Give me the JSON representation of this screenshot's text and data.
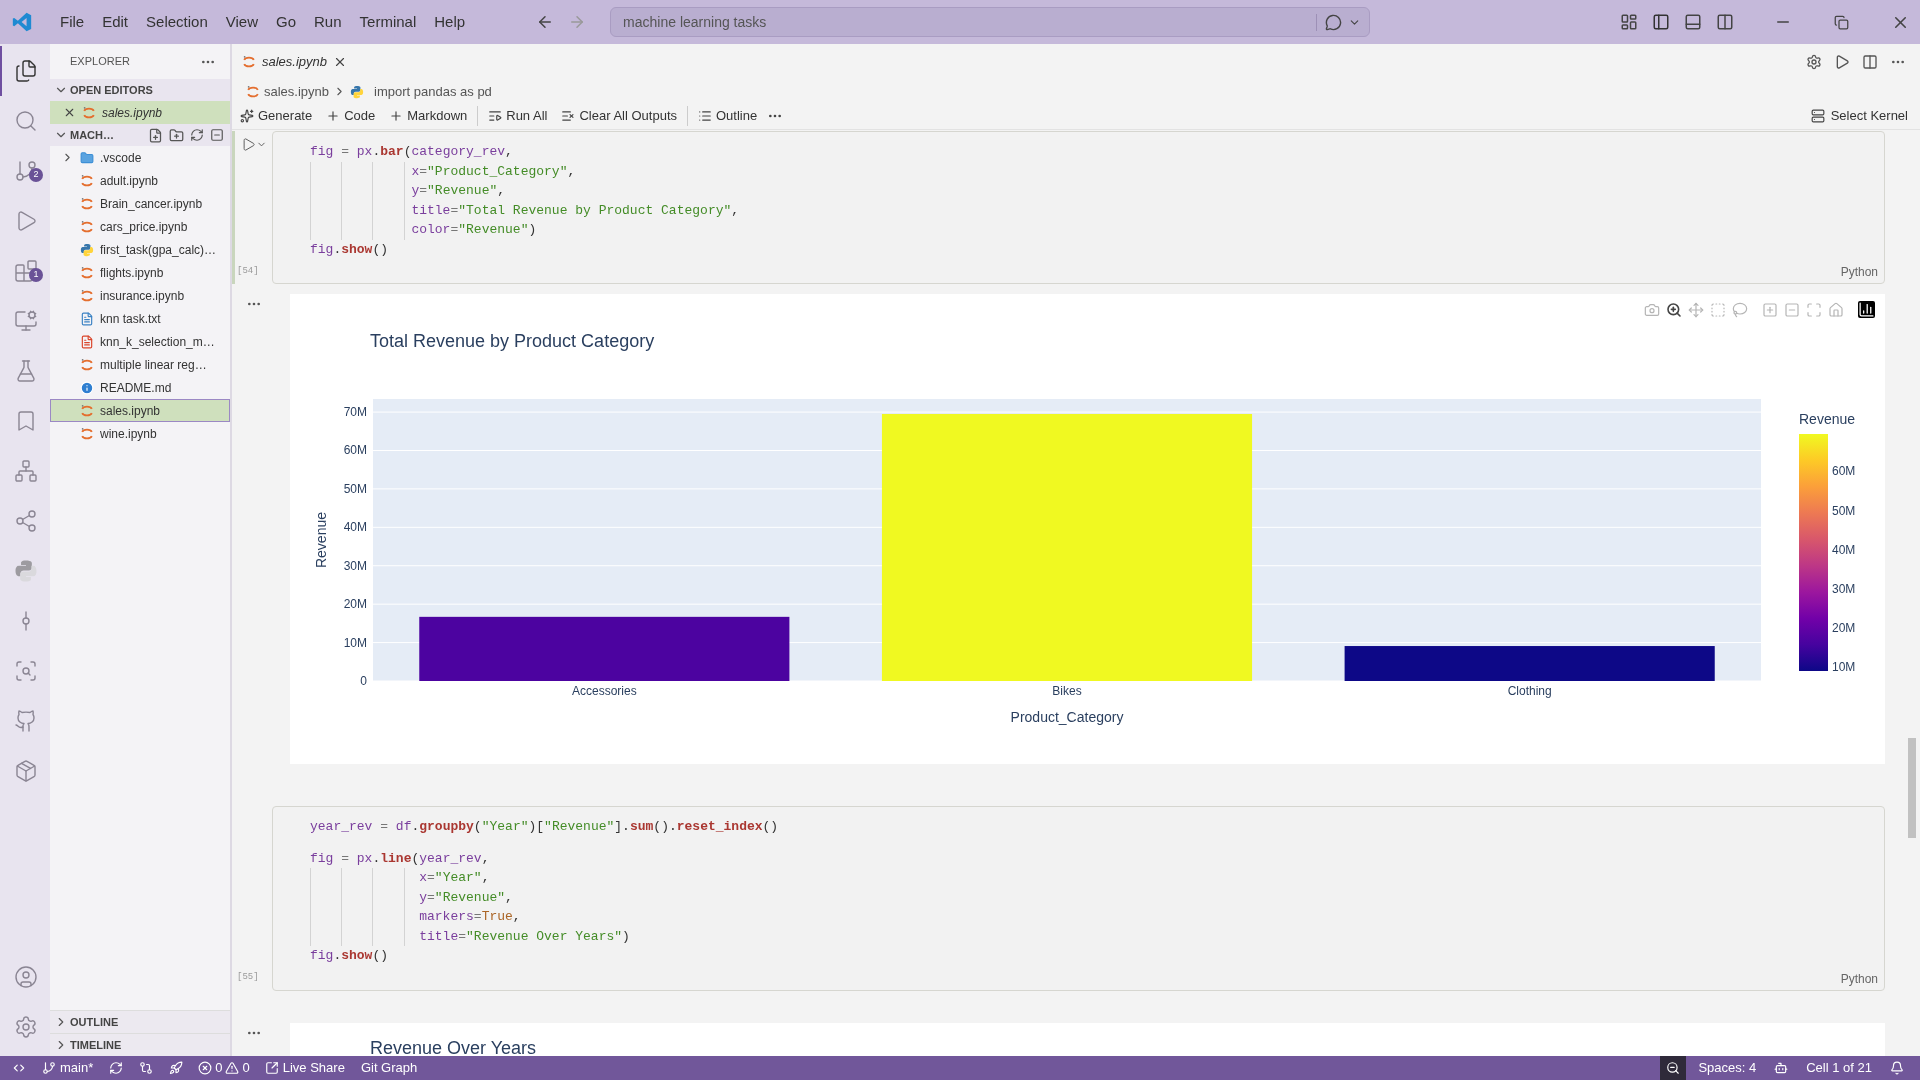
{
  "title_bar": {
    "menu": [
      "File",
      "Edit",
      "Selection",
      "View",
      "Go",
      "Run",
      "Terminal",
      "Help"
    ],
    "command_center": "machine learning tasks"
  },
  "activity_bar": {
    "items": [
      {
        "kind": "files",
        "selected": true
      },
      {
        "kind": "search",
        "selected": false
      },
      {
        "kind": "source_control",
        "selected": false,
        "badge": "2"
      },
      {
        "kind": "run_debug",
        "selected": false
      },
      {
        "kind": "extensions",
        "selected": false,
        "badge": "1"
      },
      {
        "kind": "remote",
        "selected": false
      },
      {
        "kind": "testing",
        "selected": false
      },
      {
        "kind": "bookmarks",
        "selected": false
      },
      {
        "kind": "diagram",
        "selected": false
      },
      {
        "kind": "live_share",
        "selected": false
      },
      {
        "kind": "python",
        "selected": false
      },
      {
        "kind": "git_graph",
        "selected": false
      },
      {
        "kind": "search_history",
        "selected": false
      },
      {
        "kind": "github",
        "selected": false
      },
      {
        "kind": "package",
        "selected": false
      }
    ],
    "bottom": [
      {
        "kind": "account"
      },
      {
        "kind": "settings"
      }
    ]
  },
  "sidebar": {
    "title": "EXPLORER",
    "sections": [
      {
        "title": "OPEN EDITORS",
        "kind": "open_editors",
        "expanded": true,
        "items": [
          {
            "name": "sales.ipynb",
            "kind": "notebook",
            "selected": true
          }
        ]
      },
      {
        "title": "MACH…",
        "kind": "folder",
        "expanded": true,
        "items": [
          {
            "name": ".vscode",
            "kind": "folder",
            "expanded": false,
            "selected": false
          },
          {
            "name": "adult.ipynb",
            "kind": "notebook",
            "selected": false
          },
          {
            "name": "Brain_cancer.ipynb",
            "kind": "notebook",
            "selected": false
          },
          {
            "name": "cars_price.ipynb",
            "kind": "notebook",
            "selected": false
          },
          {
            "name": "first_task(gpa_calc)…",
            "kind": "python",
            "selected": false
          },
          {
            "name": "flights.ipynb",
            "kind": "notebook",
            "selected": false
          },
          {
            "name": "insurance.ipynb",
            "kind": "notebook",
            "selected": false
          },
          {
            "name": "knn task.txt",
            "kind": "text",
            "selected": false
          },
          {
            "name": "knn_k_selection_m…",
            "kind": "pdf",
            "selected": false
          },
          {
            "name": "multiple linear reg…",
            "kind": "notebook",
            "selected": false
          },
          {
            "name": "README.md",
            "kind": "info",
            "selected": false
          },
          {
            "name": "sales.ipynb",
            "kind": "notebook",
            "selected": true
          },
          {
            "name": "wine.ipynb",
            "kind": "notebook",
            "selected": false
          }
        ]
      }
    ],
    "bottom_sections": [
      {
        "title": "OUTLINE",
        "expanded": false
      },
      {
        "title": "TIMELINE",
        "expanded": false
      }
    ]
  },
  "editor": {
    "tabs": [
      {
        "label": "sales.ipynb",
        "selected": true
      }
    ],
    "breadcrumb": [
      "sales.ipynb",
      "import pandas as pd"
    ],
    "toolbar_groups": [
      [
        {
          "kind": "generate",
          "label": "Generate"
        },
        {
          "kind": "add",
          "label": "Code"
        },
        {
          "kind": "add",
          "label": "Markdown"
        }
      ],
      [
        {
          "kind": "run_all",
          "label": "Run All"
        },
        {
          "kind": "clear",
          "label": "Clear All Outputs"
        }
      ],
      [
        {
          "kind": "outline",
          "label": "Outline"
        }
      ]
    ],
    "kernel": "Select Kernel",
    "cells": [
      {
        "execution_count": "[54]",
        "language": "Python",
        "focused": true,
        "blocks": [
          [
            {
              "continuation": false,
              "tokens": [
                {
                  "text": "fig",
                  "kind": "name"
                },
                {
                  "text": " = ",
                  "kind": "op"
                },
                {
                  "text": "px",
                  "kind": "name"
                },
                {
                  "text": ".",
                  "kind": "punc"
                },
                {
                  "text": "bar",
                  "kind": "func"
                },
                {
                  "text": "(",
                  "kind": "punc"
                },
                {
                  "text": "category_rev",
                  "kind": "name"
                },
                {
                  "text": ",",
                  "kind": "punc"
                }
              ]
            },
            {
              "continuation": true,
              "tokens": [
                {
                  "text": "x",
                  "kind": "name"
                },
                {
                  "text": "=",
                  "kind": "op"
                },
                {
                  "text": "\"Product_Category\"",
                  "kind": "str"
                },
                {
                  "text": ",",
                  "kind": "punc"
                }
              ]
            },
            {
              "continuation": true,
              "tokens": [
                {
                  "text": "y",
                  "kind": "name"
                },
                {
                  "text": "=",
                  "kind": "op"
                },
                {
                  "text": "\"Revenue\"",
                  "kind": "str"
                },
                {
                  "text": ",",
                  "kind": "punc"
                }
              ]
            },
            {
              "continuation": true,
              "tokens": [
                {
                  "text": "title",
                  "kind": "name"
                },
                {
                  "text": "=",
                  "kind": "op"
                },
                {
                  "text": "\"Total Revenue by Product Category\"",
                  "kind": "str"
                },
                {
                  "text": ",",
                  "kind": "punc"
                }
              ]
            },
            {
              "continuation": true,
              "tokens": [
                {
                  "text": "color",
                  "kind": "name"
                },
                {
                  "text": "=",
                  "kind": "op"
                },
                {
                  "text": "\"Revenue\"",
                  "kind": "str"
                },
                {
                  "text": ")",
                  "kind": "punc"
                }
              ]
            },
            {
              "continuation": false,
              "tokens": [
                {
                  "text": "fig",
                  "kind": "name"
                },
                {
                  "text": ".",
                  "kind": "punc"
                },
                {
                  "text": "show",
                  "kind": "func"
                },
                {
                  "text": "()",
                  "kind": "punc"
                }
              ]
            }
          ]
        ],
        "output": {
          "kind": "chart",
          "modebar": [
            {
              "kind": "camera",
              "selected": false
            },
            {
              "kind": "zoom",
              "selected": true
            },
            {
              "kind": "pan",
              "selected": false
            },
            {
              "kind": "box_select",
              "selected": false
            },
            {
              "kind": "lasso",
              "selected": false
            },
            {
              "kind": "zoom_in",
              "selected": false
            },
            {
              "kind": "zoom_out",
              "selected": false
            },
            {
              "kind": "autoscale",
              "selected": false
            },
            {
              "kind": "reset",
              "selected": false
            },
            {
              "kind": "logo",
              "selected": false
            }
          ],
          "chart_data": {
            "type": "bar",
            "title": "Total Revenue by Product Category",
            "xlabel": "Product_Category",
            "ylabel": "Revenue",
            "categories": [
              "Accessories",
              "Bikes",
              "Clothing"
            ],
            "series": [
              {
                "name": "Revenue",
                "values": [
                  16700000,
                  69500000,
                  9100000
                ]
              }
            ],
            "ylim": [
              0,
              73400000
            ],
            "grid": true,
            "yticks": [
              {
                "value": 0,
                "label": "0"
              },
              {
                "value": 10000000,
                "label": "10M"
              },
              {
                "value": 20000000,
                "label": "20M"
              },
              {
                "value": 30000000,
                "label": "30M"
              },
              {
                "value": 40000000,
                "label": "40M"
              },
              {
                "value": 50000000,
                "label": "50M"
              },
              {
                "value": 60000000,
                "label": "60M"
              },
              {
                "value": 70000000,
                "label": "70M"
              }
            ]
          },
          "colorbar": {
            "ticks": [
              "60M",
              "50M",
              "40M",
              "30M",
              "20M",
              "10M"
            ]
          }
        }
      },
      {
        "execution_count": "[55]",
        "language": "Python",
        "focused": false,
        "blocks": [
          [
            {
              "continuation": false,
              "tokens": [
                {
                  "text": "year_rev",
                  "kind": "name"
                },
                {
                  "text": " = ",
                  "kind": "op"
                },
                {
                  "text": "df",
                  "kind": "name"
                },
                {
                  "text": ".",
                  "kind": "punc"
                },
                {
                  "text": "groupby",
                  "kind": "func"
                },
                {
                  "text": "(",
                  "kind": "punc"
                },
                {
                  "text": "\"Year\"",
                  "kind": "str"
                },
                {
                  "text": ")[",
                  "kind": "punc"
                },
                {
                  "text": "\"Revenue\"",
                  "kind": "str"
                },
                {
                  "text": "].",
                  "kind": "punc"
                },
                {
                  "text": "sum",
                  "kind": "func"
                },
                {
                  "text": "().",
                  "kind": "punc"
                },
                {
                  "text": "reset_index",
                  "kind": "func"
                },
                {
                  "text": "()",
                  "kind": "punc"
                }
              ]
            }
          ],
          [
            {
              "continuation": false,
              "tokens": [
                {
                  "text": "fig",
                  "kind": "name"
                },
                {
                  "text": " = ",
                  "kind": "op"
                },
                {
                  "text": "px",
                  "kind": "name"
                },
                {
                  "text": ".",
                  "kind": "punc"
                },
                {
                  "text": "line",
                  "kind": "func"
                },
                {
                  "text": "(",
                  "kind": "punc"
                },
                {
                  "text": "year_rev",
                  "kind": "name"
                },
                {
                  "text": ",",
                  "kind": "punc"
                }
              ]
            },
            {
              "continuation": true,
              "tokens": [
                {
                  "text": "x",
                  "kind": "name"
                },
                {
                  "text": "=",
                  "kind": "op"
                },
                {
                  "text": "\"Year\"",
                  "kind": "str"
                },
                {
                  "text": ",",
                  "kind": "punc"
                }
              ]
            },
            {
              "continuation": true,
              "tokens": [
                {
                  "text": "y",
                  "kind": "name"
                },
                {
                  "text": "=",
                  "kind": "op"
                },
                {
                  "text": "\"Revenue\"",
                  "kind": "str"
                },
                {
                  "text": ",",
                  "kind": "punc"
                }
              ]
            },
            {
              "continuation": true,
              "tokens": [
                {
                  "text": "markers",
                  "kind": "name"
                },
                {
                  "text": "=",
                  "kind": "op"
                },
                {
                  "text": "True",
                  "kind": "const"
                },
                {
                  "text": ",",
                  "kind": "punc"
                }
              ]
            },
            {
              "continuation": true,
              "tokens": [
                {
                  "text": "title",
                  "kind": "name"
                },
                {
                  "text": "=",
                  "kind": "op"
                },
                {
                  "text": "\"Revenue Over Years\"",
                  "kind": "str"
                },
                {
                  "text": ")",
                  "kind": "punc"
                }
              ]
            },
            {
              "continuation": false,
              "tokens": [
                {
                  "text": "fig",
                  "kind": "name"
                },
                {
                  "text": ".",
                  "kind": "punc"
                },
                {
                  "text": "show",
                  "kind": "func"
                },
                {
                  "text": "()",
                  "kind": "punc"
                }
              ]
            }
          ]
        ],
        "output": {
          "kind": "title",
          "title": "Revenue Over Years"
        }
      }
    ]
  },
  "status_bar": {
    "left": [
      {
        "kind": "remote"
      },
      {
        "kind": "branch",
        "label": "main*"
      },
      {
        "kind": "sync"
      },
      {
        "kind": "compare"
      },
      {
        "kind": "rocket"
      },
      {
        "kind": "problems",
        "errors": "0",
        "warnings": "0"
      },
      {
        "kind": "live_share",
        "label": "Live Share"
      },
      {
        "kind": "text",
        "label": "Git Graph"
      }
    ],
    "right": [
      {
        "kind": "zoom"
      },
      {
        "kind": "text",
        "label": "Spaces: 4"
      },
      {
        "kind": "copilot"
      },
      {
        "kind": "text",
        "label": "Cell 1 of 21"
      },
      {
        "kind": "bell"
      }
    ]
  }
}
